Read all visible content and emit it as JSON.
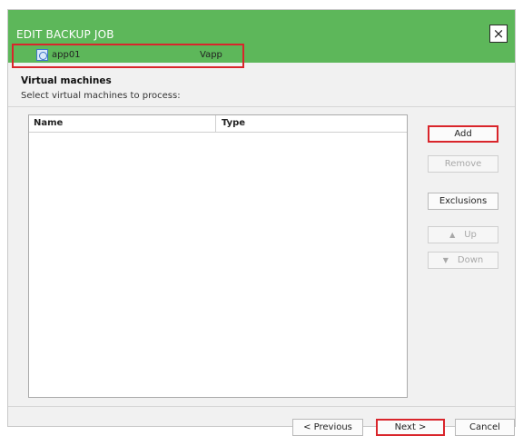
{
  "dialog": {
    "title": "EDIT BACKUP JOB",
    "close_icon": "×",
    "section_title": "Virtual machines",
    "section_subtitle": "Select virtual machines to process:"
  },
  "table": {
    "headers": [
      "Name",
      "Type"
    ],
    "rows": [
      {
        "name": "app01",
        "type": "Vapp",
        "icon": "vapp-icon"
      }
    ]
  },
  "side_buttons": {
    "add": "Add",
    "remove": "Remove",
    "exclusions": "Exclusions",
    "up": "Up",
    "down": "Down",
    "up_arrow": "▲",
    "down_arrow": "▼"
  },
  "footer_buttons": {
    "previous": "< Previous",
    "next": "Next >",
    "cancel": "Cancel"
  },
  "colors": {
    "title_bar": "#5db75a",
    "highlight": "#d9252b"
  }
}
